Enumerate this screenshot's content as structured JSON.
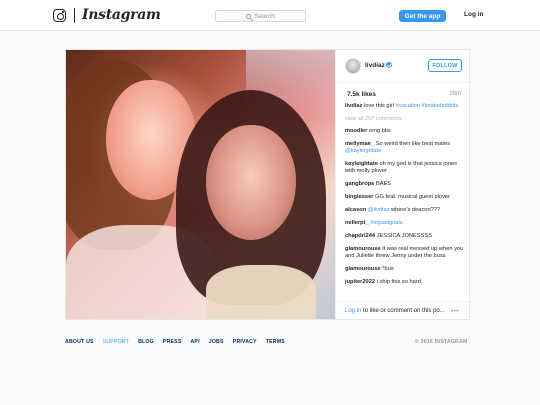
{
  "header": {
    "wordmark": "Instagram",
    "search_placeholder": "Search",
    "get_app_label": "Get the app",
    "login_label": "Log in"
  },
  "post": {
    "username": "livdiaz",
    "follow_label": "FOLLOW",
    "likes": "7.5k likes",
    "time": "28m",
    "caption": {
      "user": "livdiaz",
      "text": "love this girl",
      "tags": "#vacation #letsbehobbits"
    },
    "view_all": "view all 257 comments",
    "comments": [
      {
        "user": "moodler",
        "text": "omg bbs"
      },
      {
        "user": "mellymae_",
        "text": "So weird their like best mates",
        "mention": "@kayleightate"
      },
      {
        "user": "kayleightate",
        "text": "oh my god is that jessica jones with molly plover"
      },
      {
        "user": "gangbrope",
        "text": "BAES"
      },
      {
        "user": "binglesser",
        "text": "GG feat. musical guest plover"
      },
      {
        "user": "alcason",
        "mention": "@livdiaz",
        "text": "where's deacon???"
      },
      {
        "user": "nellerpt_",
        "mention": "#squadgoals"
      },
      {
        "user": "chapdri244",
        "text": "JESSICA JONESSSS"
      },
      {
        "user": "glamourouse",
        "text": "it was real messed up when you and Juliette threw Jenny under the buss"
      },
      {
        "user": "glamourouse",
        "text": "*bus"
      },
      {
        "user": "jupiter2022",
        "text": "i ship this so hard"
      }
    ],
    "login_prompt": {
      "link": "Log in",
      "rest": " to like or comment on this po..."
    },
    "more_label": "•••"
  },
  "footer": {
    "links": [
      "ABOUT US",
      "SUPPORT",
      "BLOG",
      "PRESS",
      "API",
      "JOBS",
      "PRIVACY",
      "TERMS"
    ],
    "copyright": "© 2016 INSTAGRAM"
  },
  "colors": {
    "accent": "#3897f0",
    "footer_link": "#003569"
  }
}
